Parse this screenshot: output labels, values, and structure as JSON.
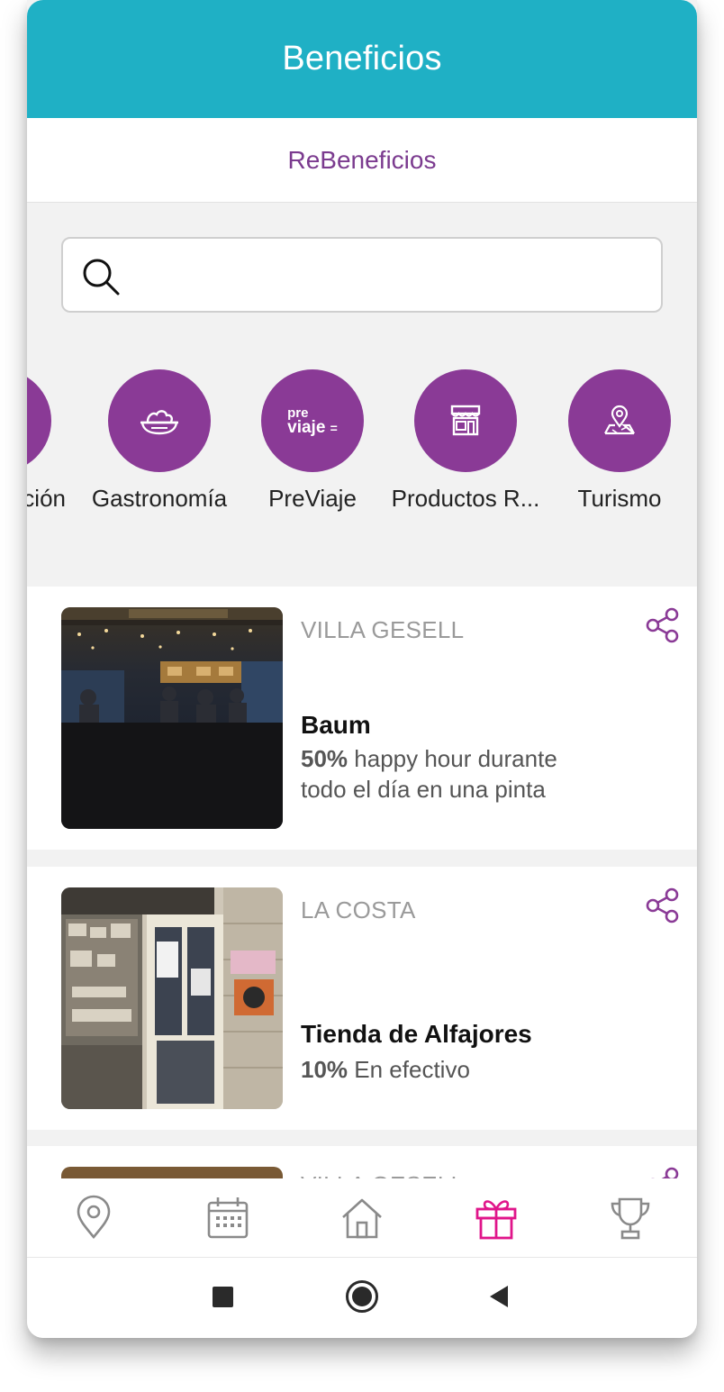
{
  "header": {
    "title": "Beneficios"
  },
  "subtab": {
    "label": "ReBeneficios"
  },
  "search": {
    "placeholder": "",
    "value": ""
  },
  "categories": [
    {
      "label": "ción",
      "icon": "partial-category-icon"
    },
    {
      "label": "Gastronomía",
      "icon": "food-plate-icon"
    },
    {
      "label": "PreViaje",
      "icon": "previaje-logo-icon",
      "logo_top": "pre",
      "logo_bottom": "viaje"
    },
    {
      "label": "Productos R...",
      "icon": "storefront-icon"
    },
    {
      "label": "Turismo",
      "icon": "map-pin-icon"
    }
  ],
  "benefits": [
    {
      "location": "VILLA GESELL",
      "name": "Baum",
      "discount": "50%",
      "description": " happy hour durante todo el día en una pinta"
    },
    {
      "location": "LA COSTA",
      "name": "Tienda de Alfajores",
      "discount": "10%",
      "description": " En efectivo"
    },
    {
      "location": "VILLA GESELL",
      "name": "",
      "discount": "",
      "description": ""
    }
  ],
  "bottom_nav": [
    {
      "icon": "location-pin-icon",
      "active": false
    },
    {
      "icon": "calendar-icon",
      "active": false
    },
    {
      "icon": "home-icon",
      "active": false
    },
    {
      "icon": "gift-icon",
      "active": true
    },
    {
      "icon": "trophy-icon",
      "active": false
    }
  ],
  "colors": {
    "header": "#1fb0c5",
    "accent_purple": "#8a3a96",
    "active_nav": "#e0158a",
    "inactive_nav": "#8a8a8a"
  }
}
